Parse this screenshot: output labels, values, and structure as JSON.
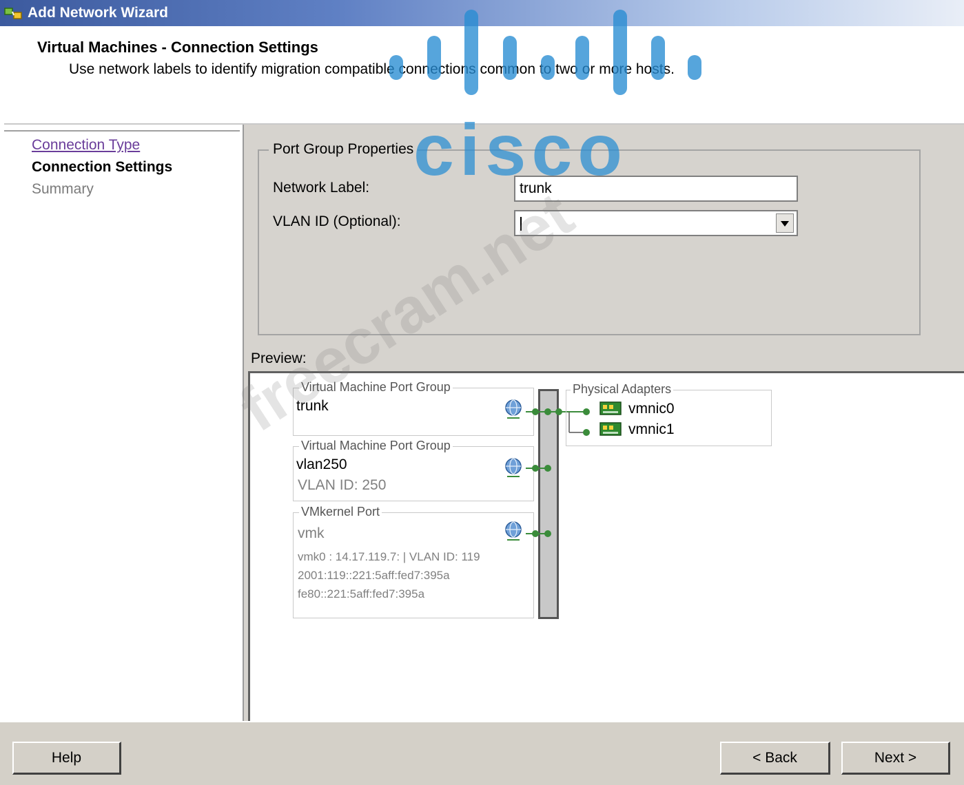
{
  "window": {
    "title": "Add Network Wizard"
  },
  "header": {
    "title": "Virtual Machines - Connection Settings",
    "subtitle": "Use network labels to identify migration compatible connections common to two or more hosts."
  },
  "nav": {
    "items": [
      {
        "label": "Connection Type",
        "state": "link"
      },
      {
        "label": "Connection Settings",
        "state": "current"
      },
      {
        "label": "Summary",
        "state": "upcoming"
      }
    ]
  },
  "port_group": {
    "legend": "Port Group Properties",
    "network_label": {
      "label": "Network Label:",
      "value": "trunk"
    },
    "vlan_id": {
      "label": "VLAN ID (Optional):",
      "value": ""
    }
  },
  "preview": {
    "label": "Preview:",
    "groups": [
      {
        "legend": "Virtual Machine Port Group",
        "name": "trunk"
      },
      {
        "legend": "Virtual Machine Port Group",
        "name": "vlan250",
        "detail": "VLAN ID: 250"
      },
      {
        "legend": "VMkernel Port",
        "name": "vmk",
        "lines": [
          "vmk0 : 14.17.119.7: | VLAN ID: 119",
          "2001:119::221:5aff:fed7:395a",
          "fe80::221:5aff:fed7:395a"
        ]
      }
    ],
    "physical_adapters": {
      "legend": "Physical Adapters",
      "nics": [
        "vmnic0",
        "vmnic1"
      ]
    }
  },
  "buttons": {
    "help": "Help",
    "back": "< Back",
    "next": "Next >"
  },
  "watermark": {
    "logo": "cisco",
    "site": "freecram.net"
  },
  "colors": {
    "link": "#6a3d9a",
    "wire": "#3b8c3b",
    "watermark": "#268cd2",
    "title_bar": "#3c5a9e"
  }
}
